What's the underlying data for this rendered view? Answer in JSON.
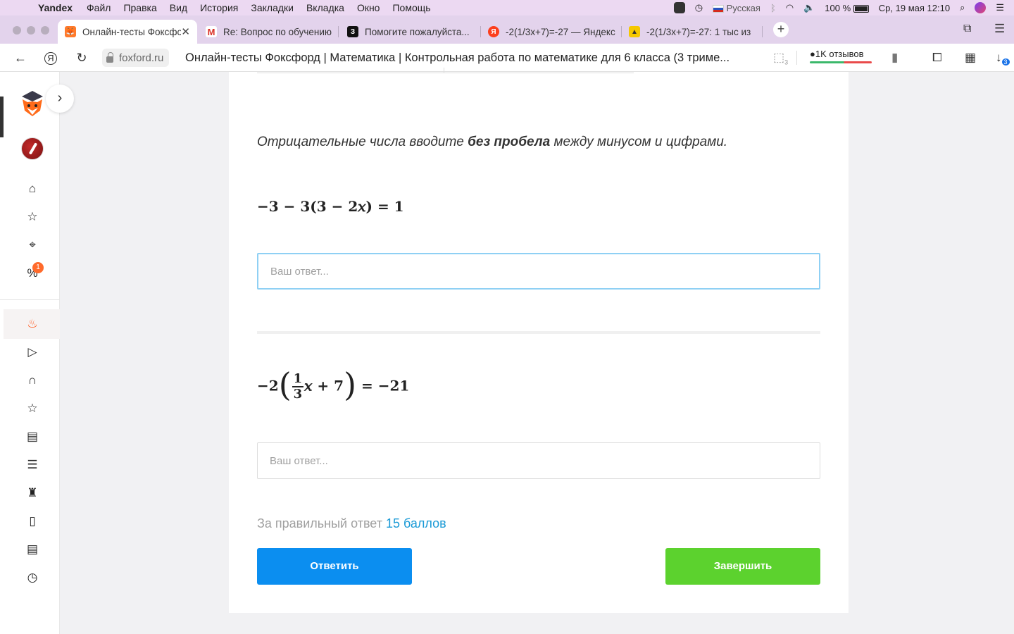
{
  "menubar": {
    "app": "Yandex",
    "items": [
      "Файл",
      "Правка",
      "Вид",
      "История",
      "Закладки",
      "Вкладка",
      "Окно",
      "Помощь"
    ],
    "keyboard": "Русская",
    "battery": "100 %",
    "datetime": "Ср, 19 мая  12:10"
  },
  "tabs": [
    {
      "title": "Онлайн-тесты Фоксфорд",
      "active": true
    },
    {
      "title": "Re: Вопрос по обучению"
    },
    {
      "title": "Помогите пожалуйста..."
    },
    {
      "title": "-2(1/3x+7)=-27 — Яндекс"
    },
    {
      "title": "-2(1/3x+7)=-27: 1 тыс из"
    }
  ],
  "address": {
    "domain": "foxford.ru",
    "title": "Онлайн-тесты Фоксфорд | Математика | Контрольная работа по математике для 6 класса (3 триме...",
    "reviews": "1K отзывов",
    "tab_count": "3",
    "downloads_count": "3"
  },
  "sidebar": {
    "notification_badge": "1",
    "icons": [
      "home-icon",
      "star-icon",
      "tag-icon",
      "percent-icon",
      "fire-icon",
      "play-icon",
      "headphones-icon",
      "star-outline-icon",
      "store-icon",
      "list-icon",
      "trophy-icon",
      "book-icon",
      "document-icon",
      "clock-icon"
    ]
  },
  "main": {
    "instruction_pre": "Отрицательные числа вводите ",
    "instruction_bold": "без пробела",
    "instruction_post": " между минусом и цифрами.",
    "q1": {
      "equation": "−3 − 3(3 − 2𝑥) = 1",
      "placeholder": "Ваш ответ..."
    },
    "q2": {
      "eq_prefix": "−2",
      "frac_num": "1",
      "frac_den": "3",
      "eq_inner": "𝑥 + 7",
      "eq_suffix": " = −21",
      "placeholder": "Ваш ответ..."
    },
    "points_label": "За правильный ответ",
    "points_value": "15 баллов",
    "answer_button": "Ответить",
    "finish_button": "Завершить"
  }
}
